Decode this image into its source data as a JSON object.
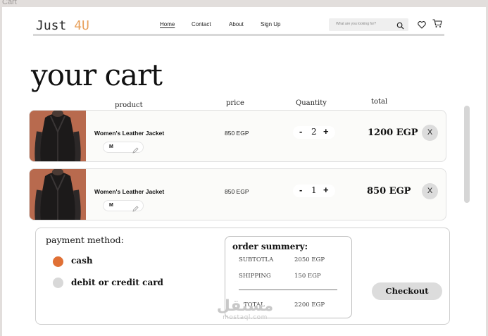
{
  "window": {
    "tab_label": "Cart"
  },
  "header": {
    "logo_main": "Just ",
    "logo_accent": "4U",
    "nav": [
      {
        "label": "Home",
        "active": true
      },
      {
        "label": "Contact",
        "active": false
      },
      {
        "label": "About",
        "active": false
      },
      {
        "label": "Sign Up",
        "active": false
      }
    ],
    "search": {
      "placeholder": "What are you looking for?",
      "icon": "search-icon"
    },
    "icons": [
      "heart-icon",
      "cart-icon"
    ]
  },
  "page_title": "your cart",
  "columns": {
    "product": "product",
    "price": "price",
    "quantity": "Quantity",
    "total": "total"
  },
  "items": [
    {
      "name": "Women's Leather Jacket",
      "size": "M",
      "price": "850 EGP",
      "qty": "2",
      "total": "1200 EGP"
    },
    {
      "name": "Women's Leather Jacket",
      "size": "M",
      "price": "850 EGP",
      "qty": "1",
      "total": "850 EGP"
    }
  ],
  "controls": {
    "minus": "-",
    "plus": "+",
    "remove": "X"
  },
  "payment": {
    "title": "payment method:",
    "options": [
      {
        "label": "cash",
        "selected": true,
        "color": "#e07035"
      },
      {
        "label": "debit or credit card",
        "selected": false,
        "color": "#d8d8d8"
      }
    ]
  },
  "summary": {
    "title": "order summery:",
    "rows": [
      {
        "label": "SUBTOTLA",
        "value": "2050 EGP"
      },
      {
        "label": "SHIPPING",
        "value": "150  EGP"
      }
    ],
    "total": {
      "label": "TOTAL",
      "value": "2200  EGP"
    }
  },
  "checkout_label": "Checkout",
  "watermark": {
    "logo": "مستقل",
    "text": "mostaql.com"
  },
  "colors": {
    "accent": "#e8a05a",
    "cash_radio": "#e07035",
    "item_bg": "#fbfbf9",
    "button_bg": "#dcdcdc"
  }
}
